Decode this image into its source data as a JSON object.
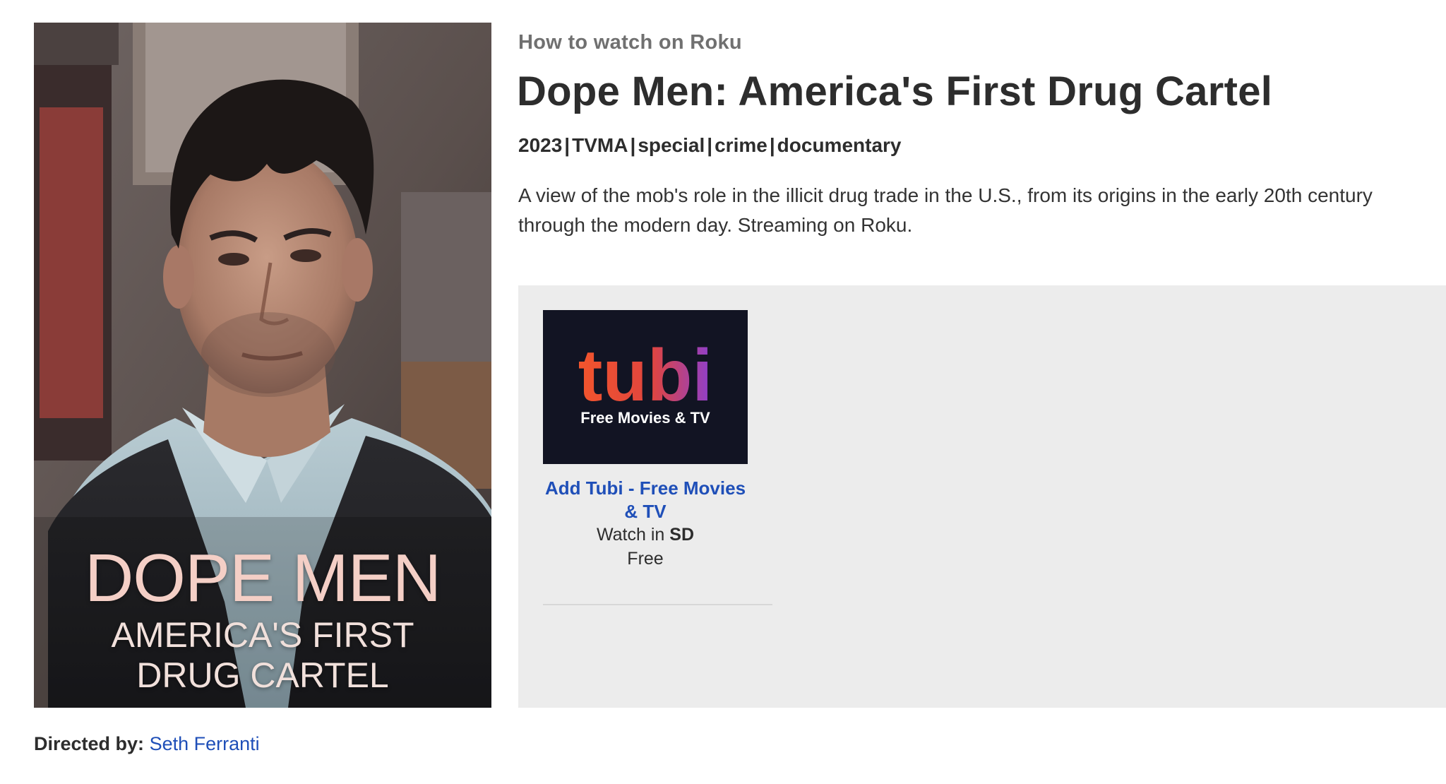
{
  "poster": {
    "title_main": "DOPE MEN",
    "title_sub_line1": "AMERICA'S FIRST",
    "title_sub_line2": "DRUG CARTEL"
  },
  "director": {
    "label": "Directed by:",
    "name": "Seth Ferranti"
  },
  "header": {
    "eyebrow": "How to watch on Roku",
    "title": "Dope Men: America's First Drug Cartel"
  },
  "meta": {
    "year": "2023",
    "rating": "TVMA",
    "type": "special",
    "genre1": "crime",
    "genre2": "documentary",
    "separator": "|"
  },
  "description": "A view of the mob's role in the illicit drug trade in the U.S., from its origins in the early 20th century through the modern day. Streaming on Roku.",
  "providers": [
    {
      "logo_word": "tubi",
      "logo_tagline": "Free Movies & TV",
      "link_label": "Add Tubi - Free Movies & TV",
      "quality_prefix": "Watch in",
      "quality": "SD",
      "price": "Free"
    }
  ],
  "colors": {
    "link": "#1f4fb8",
    "panel_bg": "#ececec",
    "tubi_bg": "#121423",
    "tubi_orange": "#f2552c",
    "tubi_purple": "#8c3fd0"
  }
}
